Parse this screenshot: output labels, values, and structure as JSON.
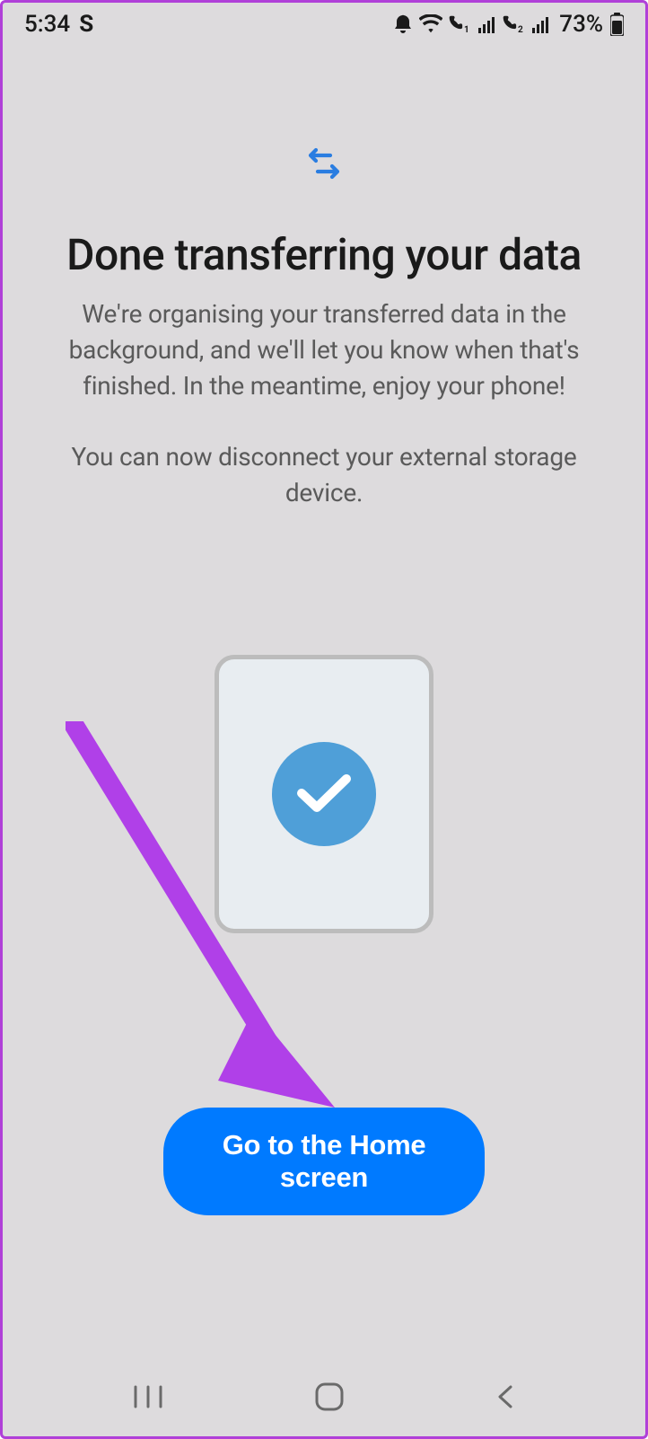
{
  "status": {
    "time": "5:34",
    "app_indicator": "S",
    "battery_text": "73%"
  },
  "transfer": {
    "title": "Done transferring your data",
    "desc": "We're organising your transferred data in the background, and we'll let you know when that's finished. In the meantime, enjoy your phone!",
    "desc2": "You can now disconnect your external storage device."
  },
  "action": {
    "home_button": "Go to the Home screen"
  }
}
